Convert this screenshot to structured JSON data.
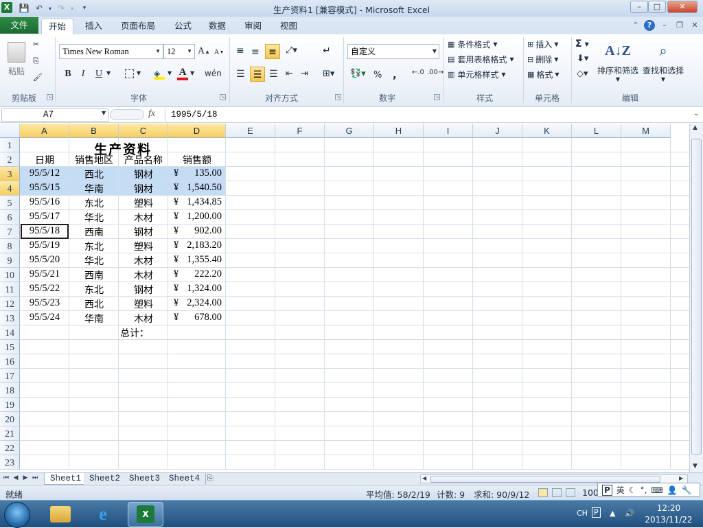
{
  "window": {
    "title": "生产资料1 [兼容模式] - Microsoft Excel",
    "app_icon": "X",
    "buttons": {
      "minimize": "–",
      "maximize": "□",
      "close": "✕"
    }
  },
  "ribbon_tabs": [
    "开始",
    "插入",
    "页面布局",
    "公式",
    "数据",
    "审阅",
    "视图"
  ],
  "file_tab": "文件",
  "ribbon": {
    "clipboard": {
      "label": "剪贴板",
      "paste": "粘贴"
    },
    "font": {
      "label": "字体",
      "name": "Times New Roman",
      "size": "12",
      "bold": "B",
      "italic": "I",
      "underline": "U",
      "grow": "A",
      "shrink": "A"
    },
    "alignment": {
      "label": "对齐方式"
    },
    "number": {
      "label": "数字",
      "format": "自定义",
      "percent": "%",
      "comma": ","
    },
    "styles": {
      "label": "样式",
      "conditional": "条件格式",
      "table": "套用表格格式",
      "cell_styles": "单元格样式"
    },
    "cells": {
      "label": "单元格",
      "insert": "插入",
      "delete": "删除",
      "format": "格式"
    },
    "editing": {
      "label": "编辑",
      "sum": "Σ",
      "sort": "排序和筛选",
      "find": "查找和选择"
    }
  },
  "formula_bar": {
    "name_box": "A7",
    "fx": "fx",
    "formula": "1995/5/18"
  },
  "columns": [
    "A",
    "B",
    "C",
    "D",
    "E",
    "F",
    "G",
    "H",
    "I",
    "J",
    "K",
    "L",
    "M"
  ],
  "rows": [
    "1",
    "2",
    "3",
    "4",
    "5",
    "6",
    "7",
    "8",
    "9",
    "10",
    "11",
    "12",
    "13",
    "14",
    "15",
    "16",
    "17",
    "18",
    "19",
    "20",
    "21",
    "22",
    "23"
  ],
  "sheet": {
    "title": "生产资料",
    "headers": [
      "日期",
      "销售地区",
      "产品名称",
      "销售额"
    ],
    "data": [
      [
        "95/5/12",
        "西北",
        "钢材",
        "¥",
        "135.00"
      ],
      [
        "95/5/15",
        "华南",
        "钢材",
        "¥",
        "1,540.50"
      ],
      [
        "95/5/16",
        "东北",
        "塑料",
        "¥",
        "1,434.85"
      ],
      [
        "95/5/17",
        "华北",
        "木材",
        "¥",
        "1,200.00"
      ],
      [
        "95/5/18",
        "西南",
        "钢材",
        "¥",
        "902.00"
      ],
      [
        "95/5/19",
        "东北",
        "塑料",
        "¥",
        "2,183.20"
      ],
      [
        "95/5/20",
        "华北",
        "木材",
        "¥",
        "1,355.40"
      ],
      [
        "95/5/21",
        "西南",
        "木材",
        "¥",
        "222.20"
      ],
      [
        "95/5/22",
        "东北",
        "钢材",
        "¥",
        "1,324.00"
      ],
      [
        "95/5/23",
        "西北",
        "塑料",
        "¥",
        "2,324.00"
      ],
      [
        "95/5/24",
        "华南",
        "木材",
        "¥",
        "678.00"
      ]
    ],
    "total_label": "总计："
  },
  "sheet_tabs": [
    "Sheet1",
    "Sheet2",
    "Sheet3",
    "Sheet4"
  ],
  "status_bar": {
    "mode": "就绪",
    "average": "平均值: 58/2/19",
    "count": "计数: 9",
    "sum": "求和: 90/9/12",
    "zoom": "100"
  },
  "ime": {
    "lang": "英"
  },
  "taskbar": {
    "lang": "CH",
    "time": "12:20",
    "date": "2013/11/22"
  }
}
